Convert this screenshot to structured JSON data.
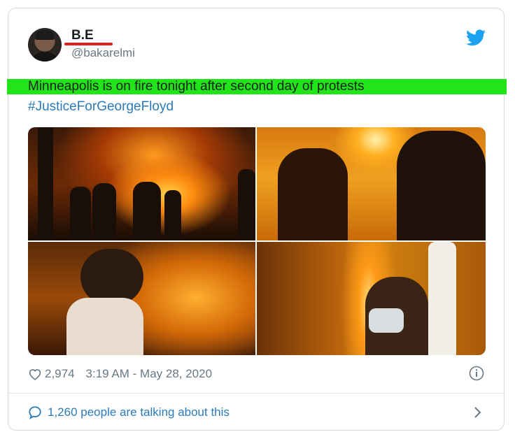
{
  "author": {
    "display_name": "B.E",
    "handle": "@bakarelmi"
  },
  "tweet": {
    "text": "Minneapolis is on fire tonight after second day of protests",
    "hashtag": "#JusticeForGeorgeFloyd"
  },
  "stats": {
    "likes": "2,974",
    "timestamp": "3:19 AM - May 28, 2020",
    "talking": "1,260 people are talking about this"
  },
  "colors": {
    "twitter_blue": "#1da1f2",
    "link_blue": "#2b7bb9",
    "highlight_green": "#22e519",
    "underline_red": "#e01e1e"
  },
  "icons": [
    "twitter-bird-icon",
    "heart-icon",
    "info-icon",
    "chat-bubble-icon",
    "chevron-right-icon"
  ]
}
